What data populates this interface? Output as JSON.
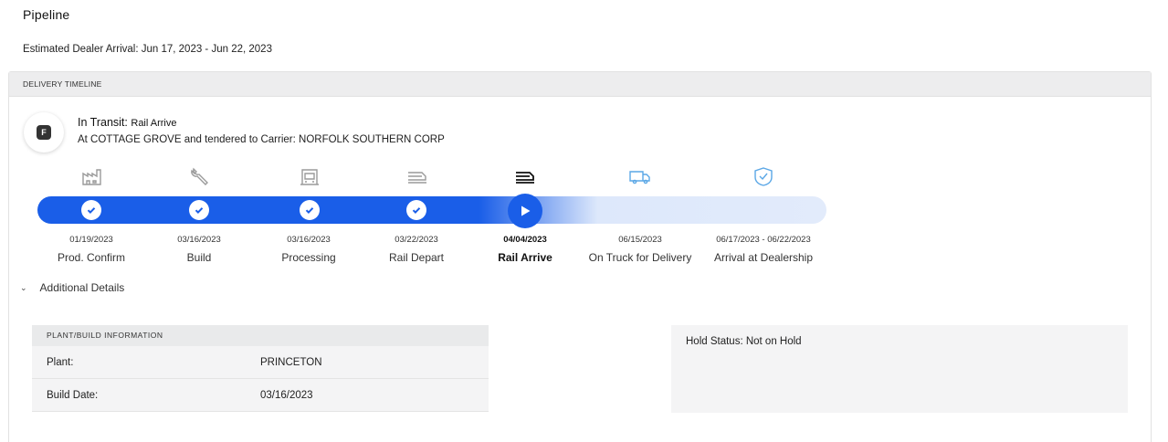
{
  "page": {
    "title": "Pipeline",
    "estimated_arrival": "Estimated Dealer Arrival: Jun 17, 2023 - Jun 22, 2023"
  },
  "timeline": {
    "header": "DELIVERY TIMELINE",
    "badge_letter": "F",
    "status_prefix": "In Transit:",
    "status_value": "Rail Arrive",
    "status_detail": "At COTTAGE GROVE and tendered to Carrier: NORFOLK SOUTHERN CORP",
    "current_stage_index": 4,
    "progress_fraction": 0.62,
    "stages": [
      {
        "label": "Prod. Confirm",
        "date": "01/19/2023",
        "icon": "factory-icon",
        "state": "complete"
      },
      {
        "label": "Build",
        "date": "03/16/2023",
        "icon": "wrench-icon",
        "state": "complete"
      },
      {
        "label": "Processing",
        "date": "03/16/2023",
        "icon": "vehicle-front-icon",
        "state": "complete"
      },
      {
        "label": "Rail Depart",
        "date": "03/22/2023",
        "icon": "railcar-icon",
        "state": "complete"
      },
      {
        "label": "Rail Arrive",
        "date": "04/04/2023",
        "icon": "railcar-icon",
        "state": "current"
      },
      {
        "label": "On Truck for Delivery",
        "date": "06/15/2023",
        "icon": "truck-icon",
        "state": "pending"
      },
      {
        "label": "Arrival at Dealership",
        "date": "06/17/2023 - 06/22/2023",
        "icon": "shield-check-icon",
        "state": "pending"
      }
    ],
    "colors": {
      "progress": "#1a5ee8",
      "track_pending": "#e2ebfb",
      "icon_done": "#9a9a9a",
      "icon_current": "#111111",
      "icon_pending": "#5aa7e6"
    }
  },
  "details": {
    "toggle_label": "Additional Details",
    "plant": {
      "header": "PLANT/BUILD INFORMATION",
      "rows": [
        {
          "key": "Plant:",
          "value": "PRINCETON"
        },
        {
          "key": "Build Date:",
          "value": "03/16/2023"
        }
      ]
    },
    "hold_status": "Hold Status: Not on Hold"
  }
}
